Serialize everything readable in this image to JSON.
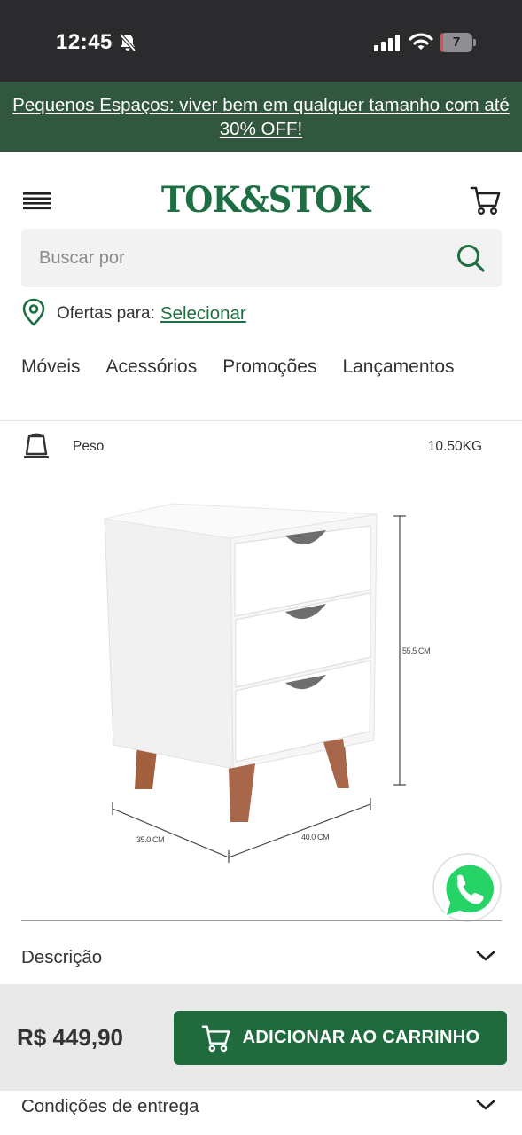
{
  "status_bar": {
    "time": "12:45",
    "battery": "7",
    "battery_level": 0.07,
    "icons": [
      "bell-slash-icon",
      "cellular-signal-icon",
      "wifi-icon",
      "battery-icon"
    ]
  },
  "promo": {
    "text": "Pequenos Espaços: viver bem em qualquer tamanho com até 30% OFF!"
  },
  "header": {
    "logo": "TOK&STOK",
    "icons": [
      "hamburger-menu-icon",
      "shopping-cart-icon"
    ]
  },
  "search": {
    "placeholder": "Buscar por",
    "value": "",
    "icon": "search-icon"
  },
  "location": {
    "icon": "map-pin-icon",
    "label": "Ofertas para:",
    "link": "Selecionar"
  },
  "nav": {
    "items": [
      "Móveis",
      "Acessórios",
      "Promoções",
      "Lançamentos"
    ]
  },
  "spec": {
    "icon": "weight-icon",
    "label": "Peso",
    "value": "10.50KG"
  },
  "product_image": {
    "height_label": "55.5 CM",
    "depth_label": "35.0 CM",
    "width_label": "40.0 CM"
  },
  "accordions": {
    "descricao": "Descrição",
    "entrega": "Condições de entrega"
  },
  "buy_bar": {
    "price": "R$ 449,90",
    "button_label": "ADICIONAR AO CARRINHO"
  },
  "colors": {
    "brand_green": "#1e6e43",
    "promo_bg": "#31573f",
    "status_bar_bg": "#2b2b2d",
    "whatsapp_green": "#25d366"
  }
}
